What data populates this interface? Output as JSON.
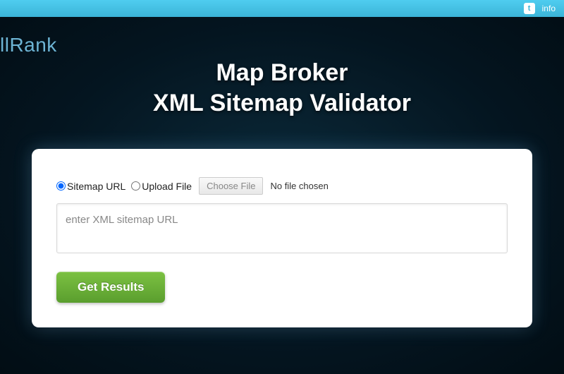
{
  "topbar": {
    "twitter_glyph": "t",
    "info_label": "info"
  },
  "logo": {
    "text": "llRank"
  },
  "title": {
    "line1": "Map Broker",
    "line2": "XML Sitemap Validator"
  },
  "form": {
    "radio_sitemap_label": "Sitemap URL",
    "radio_upload_label": "Upload File",
    "choose_file_label": "Choose File",
    "file_status": "No file chosen",
    "url_placeholder": "enter XML sitemap URL",
    "submit_label": "Get Results"
  }
}
